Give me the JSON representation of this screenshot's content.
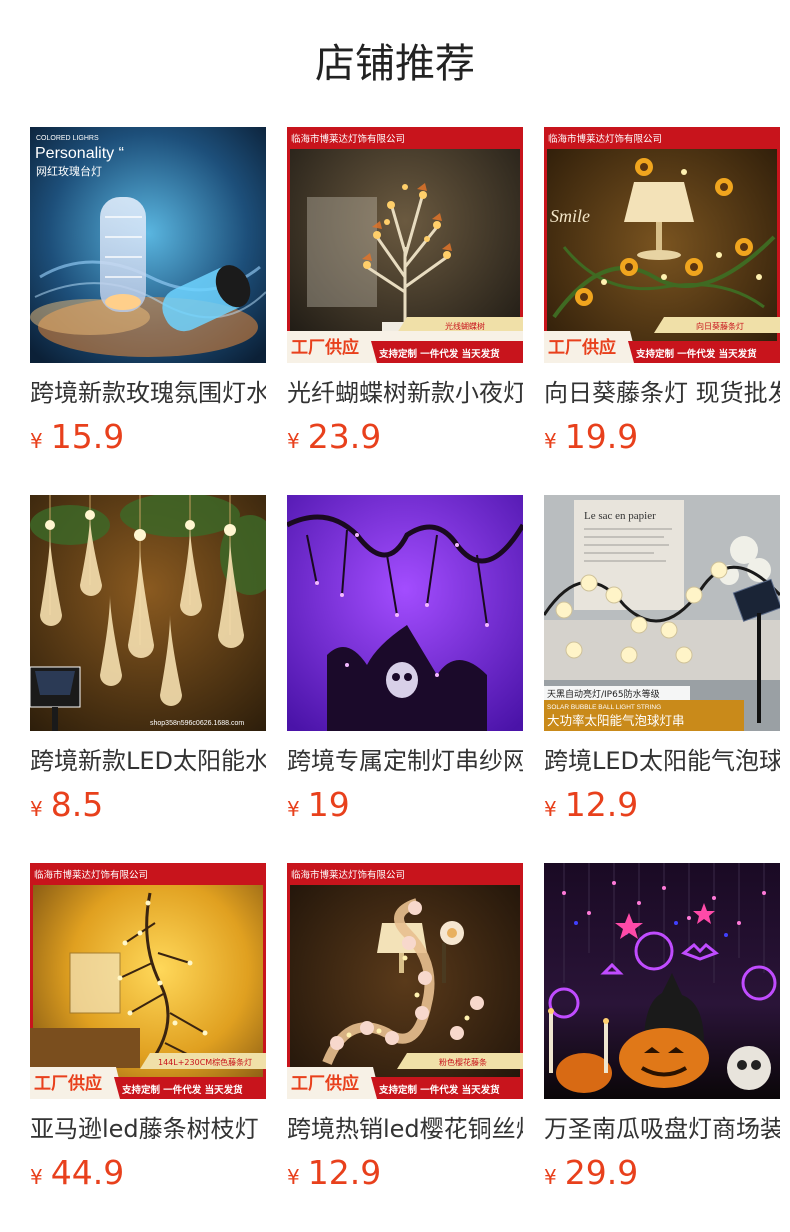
{
  "title": "店铺推荐",
  "currency": "¥",
  "colors": {
    "price": "#e8401c",
    "banner": "#c8141c",
    "factory": "#e8401c"
  },
  "products": [
    {
      "name": "跨境新款玫瑰氛围灯水晶台灯",
      "price": "15.9",
      "image": {
        "kind": "rose-lamp",
        "label_small": "COLORED LIGHRS",
        "label_big": "Personality “",
        "label_cn": "网红玫瑰台灯"
      }
    },
    {
      "name": "光纤蝴蝶树新款小夜灯",
      "price": "23.9",
      "image": {
        "kind": "butterfly-tree",
        "company": "临海市博莱达灯饰有限公司",
        "tag": "光线蝴蝶树",
        "factory": "工厂供应",
        "services": "支持定制 一件代发 当天发货"
      }
    },
    {
      "name": "向日葵藤条灯 现货批发",
      "price": "19.9",
      "image": {
        "kind": "sunflower-vine",
        "company": "临海市博莱达灯饰有限公司",
        "tag": "向日葵藤条灯",
        "factory": "工厂供应",
        "services": "支持定制 一件代发 当天发货"
      }
    },
    {
      "name": "跨境新款LED太阳能水滴灯串",
      "price": "8.5",
      "image": {
        "kind": "solar-drops",
        "watermark": "shop358n596c0626.1688.com"
      }
    },
    {
      "name": "跨境专属定制灯串纱网灯",
      "price": "19",
      "image": {
        "kind": "halloween-purple"
      }
    },
    {
      "name": "跨境LED太阳能气泡球灯串",
      "price": "12.9",
      "image": {
        "kind": "solar-bubble",
        "paper_text": "Le sac en papier",
        "caption1": "天黑自动亮灯/IP65防水等级",
        "caption_en": "SOLAR BUBBLE BALL LIGHT STRING",
        "caption2": "大功率太阳能气泡球灯串"
      }
    },
    {
      "name": "亚马逊led藤条树枝灯",
      "price": "44.9",
      "image": {
        "kind": "branch-vine",
        "company": "临海市博莱达灯饰有限公司",
        "tag": "144L+230CM棕色藤条灯",
        "factory": "工厂供应",
        "services": "支持定制 一件代发 当天发货"
      }
    },
    {
      "name": "跨境热销led樱花铜丝灯",
      "price": "12.9",
      "image": {
        "kind": "sakura-vine",
        "company": "临海市博莱达灯饰有限公司",
        "tag": "粉色樱花藤条",
        "factory": "工厂供应",
        "services": "支持定制 一件代发 当天发货"
      }
    },
    {
      "name": "万圣南瓜吸盘灯商场装饰",
      "price": "29.9",
      "image": {
        "kind": "pumpkin-curtain"
      }
    }
  ]
}
